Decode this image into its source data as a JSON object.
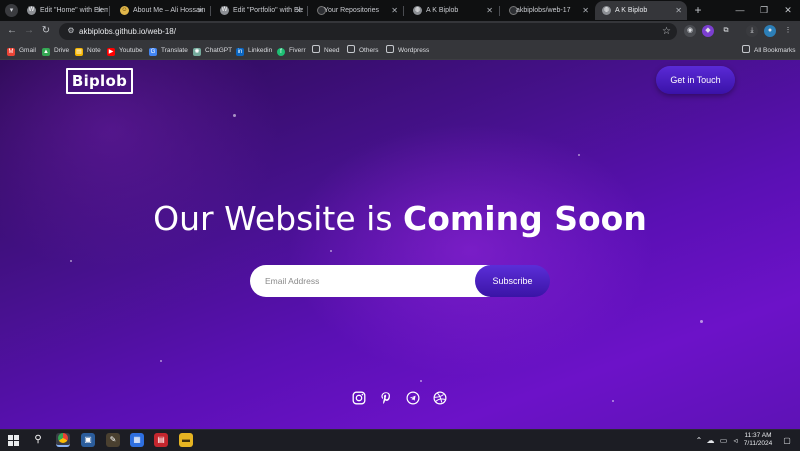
{
  "browser": {
    "tabs": [
      {
        "title": "Edit \"Home\" with Eleme",
        "icon": "wordpress-icon",
        "color": "#8c8f94"
      },
      {
        "title": "About Me – Ali Hossain",
        "icon": "smiley-icon",
        "color": "#e0b64a"
      },
      {
        "title": "Edit \"Portfolio\" with Ele",
        "icon": "wordpress-icon",
        "color": "#8c8f94"
      },
      {
        "title": "Your Repositories",
        "icon": "github-icon",
        "color": "#2d2f33"
      },
      {
        "title": "A K Biplob",
        "icon": "globe-icon",
        "color": "#8c8f94"
      },
      {
        "title": "akbiplobs/web-17",
        "icon": "github-icon",
        "color": "#2d2f33"
      },
      {
        "title": "A K Biplob",
        "icon": "globe-icon",
        "color": "#8c8f94",
        "active": true
      }
    ],
    "address": "akbiplobs.github.io/web-18/",
    "bookmarks": [
      {
        "label": "Gmail",
        "color": "#ea4335"
      },
      {
        "label": "Drive",
        "color": "#34a853"
      },
      {
        "label": "Note",
        "color": "#f4b400"
      },
      {
        "label": "Youtube",
        "color": "#ff0000"
      },
      {
        "label": "Translate",
        "color": "#4285f4"
      },
      {
        "label": "ChatGPT",
        "color": "#74aa9c"
      },
      {
        "label": "Linkedin",
        "color": "#0a66c2"
      },
      {
        "label": "Fiverr",
        "color": "#1dbf73"
      },
      {
        "label": "Need",
        "color": "folder"
      },
      {
        "label": "Others",
        "color": "folder"
      },
      {
        "label": "Wordpress",
        "color": "folder"
      }
    ],
    "all_bookmarks": "All Bookmarks"
  },
  "page": {
    "logo": "Biplob",
    "cta": "Get in Touch",
    "headline_plain": "Our Website is ",
    "headline_bold": "Coming Soon",
    "email_placeholder": "Email Address",
    "subscribe": "Subscribe",
    "social": [
      "instagram-icon",
      "pinterest-icon",
      "telegram-icon",
      "dribbble-icon"
    ]
  },
  "taskbar": {
    "time": "11:37 AM",
    "date": "7/11/2024"
  },
  "colors": {
    "accent": "#5a2ad6",
    "bg_dark": "#2b0a52",
    "bg_light": "#6c12c8"
  }
}
